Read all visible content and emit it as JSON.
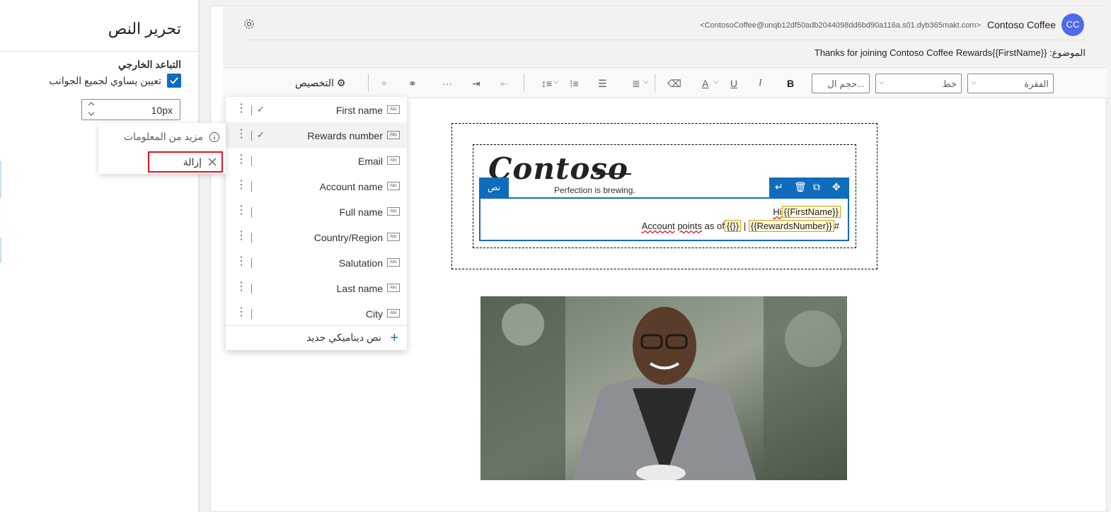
{
  "left_panel": {
    "title": "تحرير النص",
    "spacing_label": "التباعد الخارجي",
    "equal_sides_label": "تعيين يساوي لجميع الجوانب",
    "spacing_value": "10px",
    "context_menu": {
      "more_info": "مزيد من المعلومات",
      "remove": "إزالة"
    }
  },
  "header": {
    "avatar_initials": "CC",
    "sender_name": "Contoso Coffee",
    "sender_email": "<ContosoCoffee@unqb12df50adb2044098dd6bd90a116a.s01.dyb365makt.com>",
    "subject_label": "الموضوع:",
    "subject_value": "Thanks for joining Contoso Coffee Rewards{{FirstName}}"
  },
  "toolbar": {
    "paragraph": "الفقرة",
    "font": "خط",
    "font_size": "حجم ال...",
    "bold": "B",
    "italic": "I",
    "underline": "U",
    "font_color": "A",
    "more": "···",
    "customize": "التخصيص"
  },
  "dynamic_text": {
    "items": [
      {
        "label": "First name",
        "checked": true
      },
      {
        "label": "Rewards number",
        "checked": true,
        "selected": true
      },
      {
        "label": "Email",
        "checked": false
      },
      {
        "label": "Account name",
        "checked": false
      },
      {
        "label": "Full name",
        "checked": false
      },
      {
        "label": "Country/Region",
        "checked": false
      },
      {
        "label": "Salutation",
        "checked": false
      },
      {
        "label": "Last name",
        "checked": false
      },
      {
        "label": "City",
        "checked": false
      }
    ],
    "abc": "Abc",
    "new_item": "نص ديناميكي جديد"
  },
  "canvas": {
    "logo": "Contoso",
    "tagline": "Perfection is brewing.",
    "text_tab": "نص",
    "line1_hi": "Hi",
    "line1_token": "{{FirstName}}",
    "line2_account": "Account",
    "line2_points": "points",
    "line2_asof": "as of",
    "line2_token1": "{{}}",
    "line2_sep": "|",
    "line2_token2": "{{RewardsNumber}}",
    "line2_hash": "#"
  }
}
